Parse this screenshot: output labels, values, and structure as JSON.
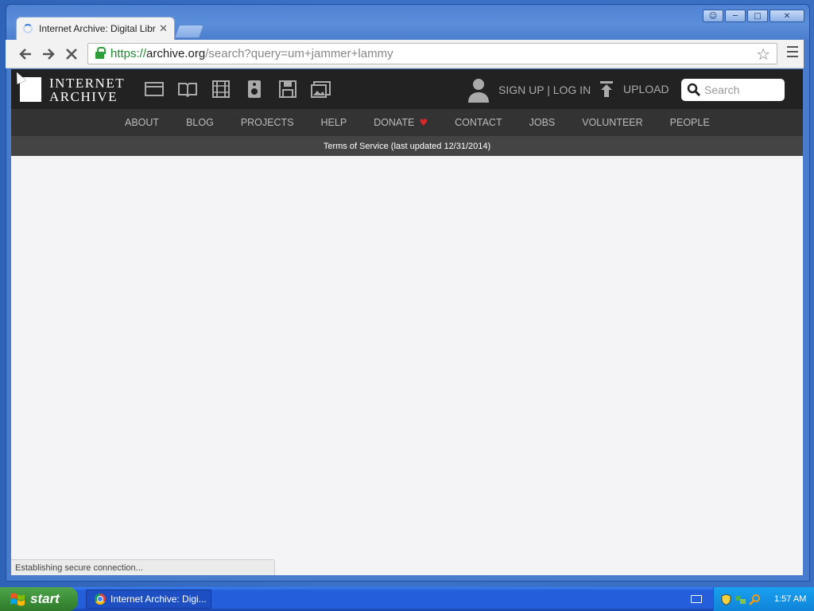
{
  "browser": {
    "tab_title": "Internet Archive: Digital Libra",
    "url_scheme": "https://",
    "url_host": "archive.org",
    "url_path": "/search?query=um+jammer+lammy",
    "status": "Establishing secure connection..."
  },
  "window_controls": {
    "user_icon": "☺",
    "min": "─",
    "max": "□",
    "close": "✕"
  },
  "ia": {
    "logo_line1": "INTERNET",
    "logo_line2": "ARCHIVE",
    "media_icons": [
      "web-icon",
      "texts-icon",
      "video-icon",
      "audio-icon",
      "software-icon",
      "images-icon"
    ],
    "signup_login": "SIGN UP | LOG IN",
    "upload": "UPLOAD",
    "search_placeholder": "Search",
    "nav": {
      "about": "ABOUT",
      "blog": "BLOG",
      "projects": "PROJECTS",
      "help": "HELP",
      "donate": "DONATE",
      "contact": "CONTACT",
      "jobs": "JOBS",
      "volunteer": "VOLUNTEER",
      "people": "PEOPLE"
    },
    "tos": "Terms of Service (last updated 12/31/2014)"
  },
  "taskbar": {
    "start": "start",
    "task_title": "Internet Archive: Digi...",
    "clock": "1:57 AM"
  },
  "colors": {
    "ia_header": "#222222",
    "ia_nav": "#333333",
    "ia_tos": "#444444",
    "heart": "#d8282c",
    "url_scheme": "#1f8a2f"
  }
}
